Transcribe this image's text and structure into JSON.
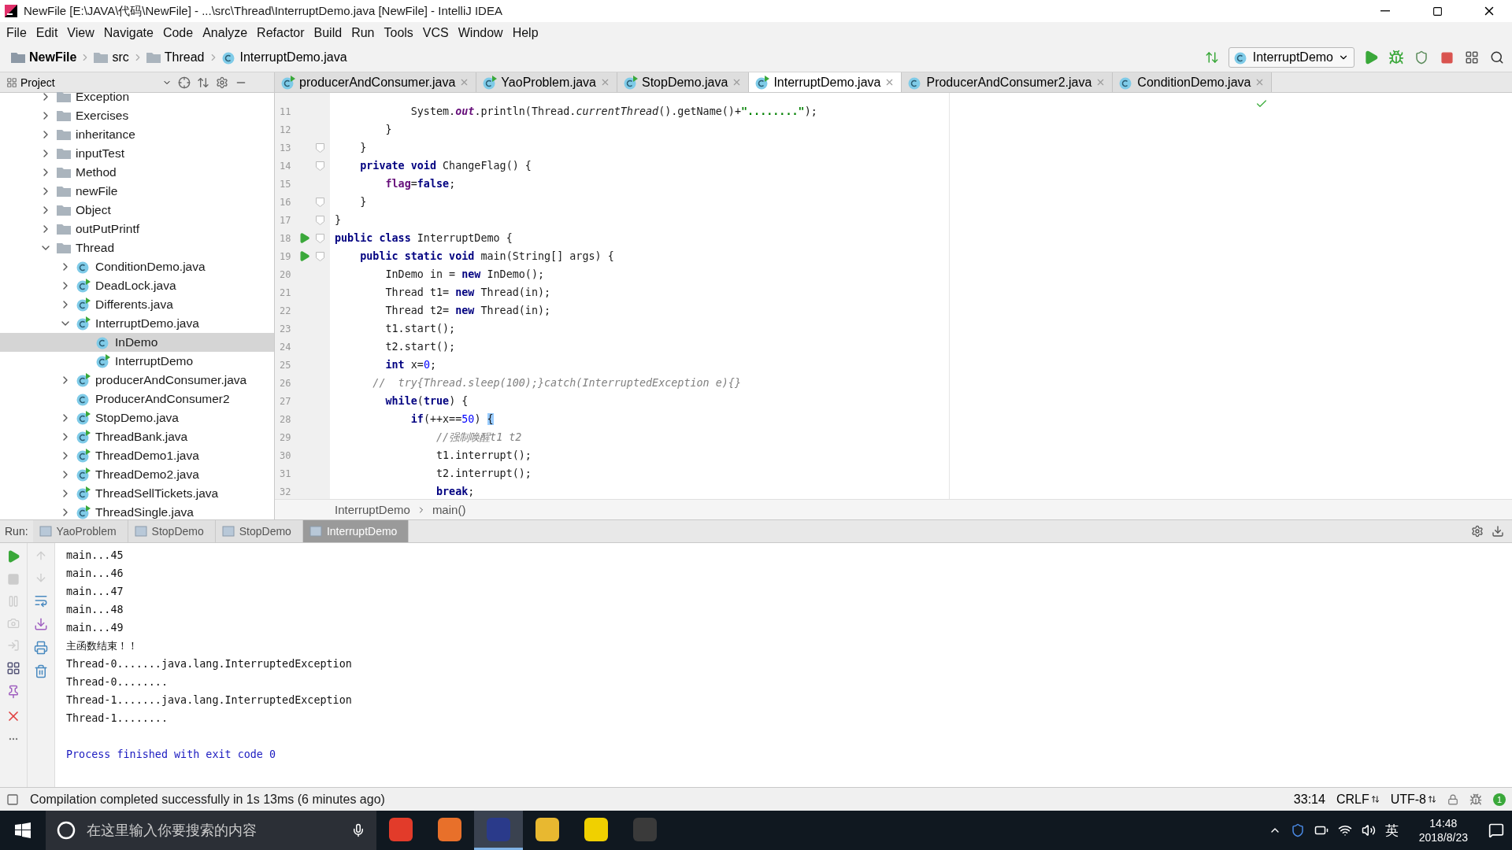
{
  "window": {
    "title": "NewFile [E:\\JAVA\\代码\\NewFile] - ...\\src\\Thread\\InterruptDemo.java [NewFile] - IntelliJ IDEA"
  },
  "menu": [
    "File",
    "Edit",
    "View",
    "Navigate",
    "Code",
    "Analyze",
    "Refactor",
    "Build",
    "Run",
    "Tools",
    "VCS",
    "Window",
    "Help"
  ],
  "nav_path": [
    {
      "label": "NewFile",
      "kind": "project"
    },
    {
      "label": "src",
      "kind": "folder"
    },
    {
      "label": "Thread",
      "kind": "folder"
    },
    {
      "label": "InterruptDemo.java",
      "kind": "class"
    }
  ],
  "run_config": "InterruptDemo",
  "project_panel": {
    "title": "Project",
    "tree": [
      {
        "label": "Exception",
        "kind": "folder",
        "has_children": true,
        "expanded": false,
        "selected": false
      },
      {
        "label": "Exercises",
        "kind": "folder",
        "has_children": true,
        "expanded": false,
        "selected": false
      },
      {
        "label": "inheritance",
        "kind": "folder",
        "has_children": true,
        "expanded": false,
        "selected": false
      },
      {
        "label": "inputTest",
        "kind": "folder",
        "has_children": true,
        "expanded": false,
        "selected": false
      },
      {
        "label": "Method",
        "kind": "folder",
        "has_children": true,
        "expanded": false,
        "selected": false
      },
      {
        "label": "newFile",
        "kind": "folder",
        "has_children": true,
        "expanded": false,
        "selected": false
      },
      {
        "label": "Object",
        "kind": "folder",
        "has_children": true,
        "expanded": false,
        "selected": false
      },
      {
        "label": "outPutPrintf",
        "kind": "folder",
        "has_children": true,
        "expanded": false,
        "selected": false
      },
      {
        "label": "Thread",
        "kind": "folder",
        "has_children": true,
        "expanded": true,
        "selected": false,
        "children": [
          {
            "label": "ConditionDemo.java",
            "kind": "class",
            "has_children": true,
            "expanded": false,
            "selected": false
          },
          {
            "label": "DeadLock.java",
            "kind": "main-class",
            "has_children": true,
            "expanded": false,
            "selected": false
          },
          {
            "label": "Differents.java",
            "kind": "main-class",
            "has_children": true,
            "expanded": false,
            "selected": false
          },
          {
            "label": "InterruptDemo.java",
            "kind": "main-class",
            "has_children": true,
            "expanded": true,
            "selected": false,
            "children": [
              {
                "label": "InDemo",
                "kind": "class",
                "has_children": false,
                "expanded": false,
                "selected": true
              },
              {
                "label": "InterruptDemo",
                "kind": "main-class",
                "has_children": false,
                "expanded": false,
                "selected": false
              }
            ]
          },
          {
            "label": "producerAndConsumer.java",
            "kind": "main-class",
            "has_children": true,
            "expanded": false,
            "selected": false
          },
          {
            "label": "ProducerAndConsumer2",
            "kind": "class",
            "has_children": false,
            "expanded": false,
            "selected": false
          },
          {
            "label": "StopDemo.java",
            "kind": "main-class",
            "has_children": true,
            "expanded": false,
            "selected": false
          },
          {
            "label": "ThreadBank.java",
            "kind": "main-class",
            "has_children": true,
            "expanded": false,
            "selected": false
          },
          {
            "label": "ThreadDemo1.java",
            "kind": "main-class",
            "has_children": true,
            "expanded": false,
            "selected": false
          },
          {
            "label": "ThreadDemo2.java",
            "kind": "main-class",
            "has_children": true,
            "expanded": false,
            "selected": false
          },
          {
            "label": "ThreadSellTickets.java",
            "kind": "main-class",
            "has_children": true,
            "expanded": false,
            "selected": false
          },
          {
            "label": "ThreadSingle.java",
            "kind": "main-class",
            "has_children": true,
            "expanded": false,
            "selected": false
          }
        ]
      }
    ]
  },
  "editor_tabs": [
    {
      "label": "producerAndConsumer.java",
      "kind": "main-class",
      "selected": false
    },
    {
      "label": "YaoProblem.java",
      "kind": "main-class",
      "selected": false
    },
    {
      "label": "StopDemo.java",
      "kind": "main-class",
      "selected": false
    },
    {
      "label": "InterruptDemo.java",
      "kind": "main-class",
      "selected": true
    },
    {
      "label": "ProducerAndConsumer2.java",
      "kind": "class",
      "selected": false
    },
    {
      "label": "ConditionDemo.java",
      "kind": "class",
      "selected": false
    }
  ],
  "code": [
    {
      "no": "11",
      "run": false,
      "fold": false,
      "tokens": [
        {
          "text": "            System.",
          "kind": "plain"
        },
        {
          "text": "out",
          "kind": "static-field"
        },
        {
          "text": ".println(Thread.",
          "kind": "plain"
        },
        {
          "text": "currentThread",
          "kind": "static"
        },
        {
          "text": "().getName()+",
          "kind": "plain"
        },
        {
          "text": "\"........\"",
          "kind": "string"
        },
        {
          "text": ");",
          "kind": "plain"
        }
      ]
    },
    {
      "no": "12",
      "run": false,
      "fold": false,
      "tokens": [
        {
          "text": "        }",
          "kind": "plain"
        }
      ]
    },
    {
      "no": "13",
      "run": false,
      "fold": true,
      "tokens": [
        {
          "text": "    }",
          "kind": "plain"
        }
      ]
    },
    {
      "no": "14",
      "run": false,
      "fold": true,
      "tokens": [
        {
          "text": "    private void",
          "kind": "keyword"
        },
        {
          "text": " ChangeFlag() {",
          "kind": "plain"
        }
      ]
    },
    {
      "no": "15",
      "run": false,
      "fold": false,
      "tokens": [
        {
          "text": "        flag",
          "kind": "field"
        },
        {
          "text": "=",
          "kind": "plain"
        },
        {
          "text": "false",
          "kind": "keyword"
        },
        {
          "text": ";",
          "kind": "plain"
        }
      ]
    },
    {
      "no": "16",
      "run": false,
      "fold": true,
      "tokens": [
        {
          "text": "    }",
          "kind": "plain"
        }
      ]
    },
    {
      "no": "17",
      "run": false,
      "fold": true,
      "tokens": [
        {
          "text": "}",
          "kind": "plain"
        }
      ]
    },
    {
      "no": "18",
      "run": true,
      "fold": true,
      "tokens": [
        {
          "text": "public class",
          "kind": "keyword"
        },
        {
          "text": " InterruptDemo {",
          "kind": "plain"
        }
      ]
    },
    {
      "no": "19",
      "run": true,
      "fold": true,
      "tokens": [
        {
          "text": "    public static void",
          "kind": "keyword"
        },
        {
          "text": " main(String[] args) {",
          "kind": "plain"
        }
      ]
    },
    {
      "no": "20",
      "run": false,
      "fold": false,
      "tokens": [
        {
          "text": "        InDemo in = ",
          "kind": "plain"
        },
        {
          "text": "new",
          "kind": "keyword"
        },
        {
          "text": " InDemo();",
          "kind": "plain"
        }
      ]
    },
    {
      "no": "21",
      "run": false,
      "fold": false,
      "tokens": [
        {
          "text": "        Thread t1= ",
          "kind": "plain"
        },
        {
          "text": "new",
          "kind": "keyword"
        },
        {
          "text": " Thread(in);",
          "kind": "plain"
        }
      ]
    },
    {
      "no": "22",
      "run": false,
      "fold": false,
      "tokens": [
        {
          "text": "        Thread t2= ",
          "kind": "plain"
        },
        {
          "text": "new",
          "kind": "keyword"
        },
        {
          "text": " Thread(in);",
          "kind": "plain"
        }
      ]
    },
    {
      "no": "23",
      "run": false,
      "fold": false,
      "tokens": [
        {
          "text": "        t1.start();",
          "kind": "plain"
        }
      ]
    },
    {
      "no": "24",
      "run": false,
      "fold": false,
      "tokens": [
        {
          "text": "        t2.start();",
          "kind": "plain"
        }
      ]
    },
    {
      "no": "25",
      "run": false,
      "fold": false,
      "tokens": [
        {
          "text": "        int",
          "kind": "keyword"
        },
        {
          "text": " x=",
          "kind": "plain"
        },
        {
          "text": "0",
          "kind": "number"
        },
        {
          "text": ";",
          "kind": "plain"
        }
      ]
    },
    {
      "no": "26",
      "run": false,
      "fold": false,
      "tokens": [
        {
          "text": "      //  try{Thread.sleep(100);}catch(InterruptedException e){}",
          "kind": "comment"
        }
      ]
    },
    {
      "no": "27",
      "run": false,
      "fold": false,
      "tokens": [
        {
          "text": "        while",
          "kind": "keyword"
        },
        {
          "text": "(",
          "kind": "plain"
        },
        {
          "text": "true",
          "kind": "keyword"
        },
        {
          "text": ") {",
          "kind": "plain"
        }
      ]
    },
    {
      "no": "28",
      "run": false,
      "fold": false,
      "tokens": [
        {
          "text": "            if",
          "kind": "keyword"
        },
        {
          "text": "(++x==",
          "kind": "plain"
        },
        {
          "text": "50",
          "kind": "number"
        },
        {
          "text": ") ",
          "kind": "plain"
        },
        {
          "text": "{",
          "kind": "brace-match"
        }
      ]
    },
    {
      "no": "29",
      "run": false,
      "fold": false,
      "tokens": [
        {
          "text": "                //强制唤醒t1 t2",
          "kind": "comment"
        }
      ]
    },
    {
      "no": "30",
      "run": false,
      "fold": false,
      "tokens": [
        {
          "text": "                t1.interrupt();",
          "kind": "plain"
        }
      ]
    },
    {
      "no": "31",
      "run": false,
      "fold": false,
      "tokens": [
        {
          "text": "                t2.interrupt();",
          "kind": "plain"
        }
      ]
    },
    {
      "no": "32",
      "run": false,
      "fold": false,
      "tokens": [
        {
          "text": "                break",
          "kind": "keyword"
        },
        {
          "text": ";",
          "kind": "plain"
        }
      ]
    }
  ],
  "editor_breadcrumb": [
    "InterruptDemo",
    "main()"
  ],
  "run_panel": {
    "label": "Run:",
    "tabs": [
      {
        "label": "YaoProblem",
        "selected": false
      },
      {
        "label": "StopDemo",
        "selected": false
      },
      {
        "label": "StopDemo",
        "selected": false
      },
      {
        "label": "InterruptDemo",
        "selected": true
      }
    ],
    "console": [
      {
        "text": "main...45",
        "kind": "out"
      },
      {
        "text": "main...46",
        "kind": "out"
      },
      {
        "text": "main...47",
        "kind": "out"
      },
      {
        "text": "main...48",
        "kind": "out"
      },
      {
        "text": "main...49",
        "kind": "out"
      },
      {
        "text": "主函数结束！！",
        "kind": "out"
      },
      {
        "text": "Thread-0.......java.lang.InterruptedException",
        "kind": "out"
      },
      {
        "text": "Thread-0........",
        "kind": "out"
      },
      {
        "text": "Thread-1.......java.lang.InterruptedException",
        "kind": "out"
      },
      {
        "text": "Thread-1........",
        "kind": "out"
      },
      {
        "text": "Process finished with exit code 0",
        "kind": "system"
      }
    ]
  },
  "status_bar": {
    "message": "Compilation completed successfully in 1s 13ms (6 minutes ago)",
    "position": "33:14",
    "line_separator": "CRLF",
    "encoding": "UTF-8",
    "notifications": "1"
  },
  "taskbar": {
    "search_placeholder": "在这里输入你要搜索的内容",
    "input_method": "英",
    "time": "14:48",
    "date": "2018/8/23"
  }
}
